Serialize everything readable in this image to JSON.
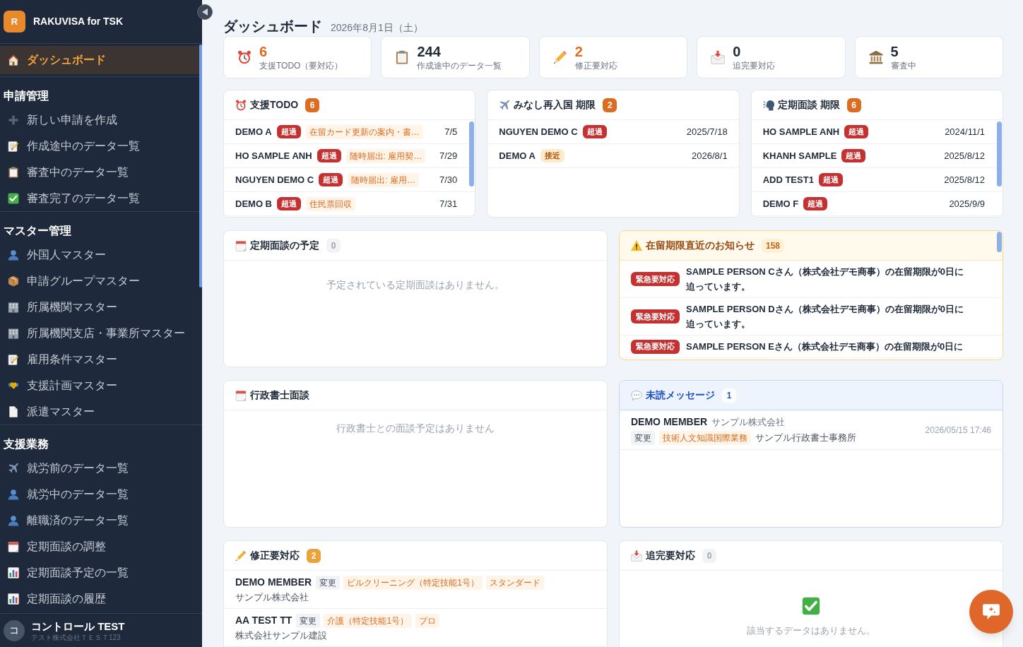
{
  "sidebar": {
    "scrollable": true,
    "logo": {
      "letter": "R",
      "title": "RAKUVISA for TSK"
    },
    "items": [
      {
        "label": "ダッシュボード",
        "selected": true
      }
    ],
    "sections": [
      {
        "title": "申請管理",
        "items": [
          {
            "label": "新しい申請を作成",
            "selected": false
          },
          {
            "label": "作成途中のデータ一覧",
            "selected": false
          },
          {
            "label": "審査中のデータ一覧",
            "selected": false
          },
          {
            "label": "審査完了のデータ一覧",
            "selected": false
          }
        ]
      },
      {
        "title": "マスター管理",
        "items": [
          {
            "label": "外国人マスター",
            "selected": false
          },
          {
            "label": "申請グループマスター",
            "selected": false
          },
          {
            "label": "所属機関マスター",
            "selected": false
          },
          {
            "label": "所属機関支店・事業所マスター",
            "selected": false
          },
          {
            "label": "雇用条件マスター",
            "selected": false
          },
          {
            "label": "支援計画マスター",
            "selected": false
          },
          {
            "label": "派遣マスター",
            "selected": false
          }
        ]
      },
      {
        "title": "支援業務",
        "items": [
          {
            "label": "就労前のデータ一覧",
            "selected": false
          },
          {
            "label": "就労中のデータ一覧",
            "selected": false
          },
          {
            "label": "離職済のデータ一覧",
            "selected": false
          },
          {
            "label": "定期面談の調整",
            "selected": false
          },
          {
            "label": "定期面談予定の一覧",
            "selected": false
          },
          {
            "label": "定期面談の履歴",
            "selected": false
          }
        ]
      }
    ],
    "user": {
      "avatar": "コ",
      "name": "コントロール TEST",
      "company": "テスト株式会社ＴＥＳＴ123"
    }
  },
  "page": {
    "title": "ダッシュボード",
    "date": "2026年8月1日（土）"
  },
  "stats": [
    {
      "value": "6",
      "label": "支援TODO（要対応）",
      "highlighted": true
    },
    {
      "value": "244",
      "label": "作成途中のデータ一覧",
      "highlighted": false
    },
    {
      "value": "2",
      "label": "修正要対応",
      "highlighted": true
    },
    {
      "value": "0",
      "label": "追完要対応",
      "highlighted": false
    },
    {
      "value": "5",
      "label": "審査中",
      "highlighted": false
    }
  ],
  "deadline_panels": [
    {
      "title": "支援TODO",
      "count": {
        "text": "6",
        "kind": "filled"
      },
      "scrollable": true,
      "rows": [
        {
          "name": "DEMO A",
          "status": {
            "text": "超過",
            "kind": "overdue"
          },
          "task": "在留カード更新の案内・書…",
          "date": "7/5"
        },
        {
          "name": "HO SAMPLE ANH",
          "status": {
            "text": "超過",
            "kind": "overdue"
          },
          "task": "随時届出: 雇用契…",
          "date": "7/29"
        },
        {
          "name": "NGUYEN DEMO C",
          "status": {
            "text": "超過",
            "kind": "overdue"
          },
          "task": "随時届出: 雇用…",
          "date": "7/30"
        },
        {
          "name": "DEMO B",
          "status": {
            "text": "超過",
            "kind": "overdue"
          },
          "task": "住民票回収",
          "date": "7/31"
        }
      ]
    },
    {
      "title": "みなし再入国 期限",
      "count": {
        "text": "2",
        "kind": "filled"
      },
      "scrollable": false,
      "rows": [
        {
          "name": "NGUYEN DEMO C",
          "status": {
            "text": "超過",
            "kind": "overdue"
          },
          "date": "2025/7/18"
        },
        {
          "name": "DEMO A",
          "status": {
            "text": "接近",
            "kind": "approaching"
          },
          "date": "2026/8/1"
        }
      ]
    },
    {
      "title": "定期面談 期限",
      "count": {
        "text": "6",
        "kind": "filled"
      },
      "scrollable": true,
      "rows": [
        {
          "name": "HO SAMPLE ANH",
          "status": {
            "text": "超過",
            "kind": "overdue"
          },
          "date": "2024/11/1"
        },
        {
          "name": "KHANH SAMPLE",
          "status": {
            "text": "超過",
            "kind": "overdue"
          },
          "date": "2025/8/12"
        },
        {
          "name": "ADD TEST1",
          "status": {
            "text": "超過",
            "kind": "overdue"
          },
          "date": "2025/8/12"
        },
        {
          "name": "DEMO F",
          "status": {
            "text": "超過",
            "kind": "overdue"
          },
          "date": "2025/9/9"
        }
      ]
    }
  ],
  "interview_schedule": {
    "title": "定期面談の予定",
    "count": {
      "text": "0",
      "kind": "muted"
    },
    "empty_message": "予定されている定期面談はありません。"
  },
  "residence_alerts": {
    "title": "在留期限直近のお知らせ",
    "kind": "warning",
    "count": {
      "text": "158",
      "kind": "warning"
    },
    "scrollable": true,
    "items": [
      {
        "badge": "緊急要対応",
        "text": "SAMPLE PERSON Cさん（株式会社デモ商事）の在留期限が0日に迫っています。"
      },
      {
        "badge": "緊急要対応",
        "text": "SAMPLE PERSON Dさん（株式会社デモ商事）の在留期限が0日に迫っています。"
      },
      {
        "badge": "緊急要対応",
        "text": "SAMPLE PERSON Eさん（株式会社デモ商事）の在留期限が0日に"
      }
    ]
  },
  "scrivener_interviews": {
    "title": "行政書士面談",
    "empty_message": "行政書士との面談予定はありません"
  },
  "unread_messages": {
    "title": "未読メッセージ",
    "kind": "info",
    "count": {
      "text": "1",
      "kind": "info"
    },
    "items": [
      {
        "sender": "DEMO MEMBER",
        "company": "サンプル株式会社",
        "tags": [
          {
            "text": "変更",
            "kind": "neutral"
          },
          {
            "text": "技術人文知識国際業務",
            "kind": "accent"
          }
        ],
        "office": "サンプル行政書士事務所",
        "time": "2026/05/15 17:46"
      }
    ]
  },
  "corrections": {
    "title": "修正要対応",
    "count": {
      "text": "2",
      "kind": "amber"
    },
    "items": [
      {
        "name": "DEMO MEMBER",
        "tags": [
          {
            "text": "変更",
            "kind": "neutral"
          },
          {
            "text": "ビルクリーニング（特定技能1号）",
            "kind": "accent"
          },
          {
            "text": "スタンダード",
            "kind": "accent"
          }
        ],
        "company": "サンプル株式会社"
      },
      {
        "name": "AA TEST TT",
        "tags": [
          {
            "text": "変更",
            "kind": "neutral"
          },
          {
            "text": "介護（特定技能1号）",
            "kind": "accent"
          },
          {
            "text": "プロ",
            "kind": "accent"
          }
        ],
        "company": "株式会社サンプル建設"
      }
    ]
  },
  "additional_requests": {
    "title": "追完要対応",
    "count": {
      "text": "0",
      "kind": "muted"
    },
    "empty_message": "該当するデータはありません。"
  }
}
